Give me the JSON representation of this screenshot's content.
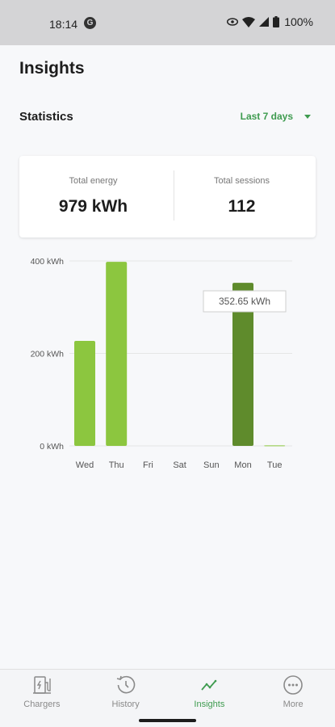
{
  "status_bar": {
    "time": "18:14",
    "battery": "100%"
  },
  "header": {
    "title": "Insights"
  },
  "statistics": {
    "title": "Statistics",
    "range": "Last 7 days",
    "total_energy_label": "Total energy",
    "total_energy_value": "979 kWh",
    "total_sessions_label": "Total sessions",
    "total_sessions_value": "112"
  },
  "colors": {
    "accent": "#3e9b4f",
    "bar": "#8cc63f",
    "bar_selected": "#5f8b2c"
  },
  "chart_data": {
    "type": "bar",
    "categories": [
      "Wed",
      "Thu",
      "Fri",
      "Sat",
      "Sun",
      "Mon",
      "Tue"
    ],
    "values": [
      227,
      398,
      0,
      0,
      0,
      352.65,
      1
    ],
    "y_ticks": [
      "400 kWh",
      "200 kWh",
      "0 kWh"
    ],
    "ylim": [
      0,
      400
    ],
    "selected_category": "Mon",
    "tooltip": "352.65 kWh",
    "grid": true
  },
  "tab_bar": {
    "tabs": [
      {
        "label": "Chargers",
        "icon": "charger-icon",
        "active": false
      },
      {
        "label": "History",
        "icon": "history-icon",
        "active": false
      },
      {
        "label": "Insights",
        "icon": "insights-icon",
        "active": true
      },
      {
        "label": "More",
        "icon": "more-icon",
        "active": false
      }
    ]
  }
}
